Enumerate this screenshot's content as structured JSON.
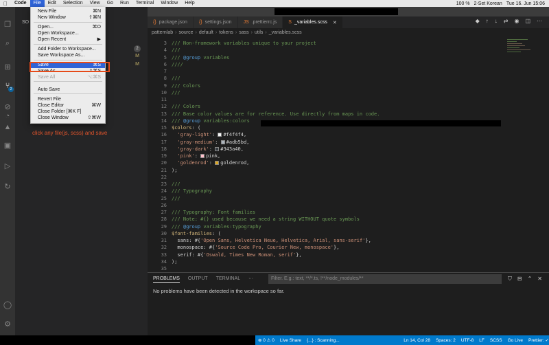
{
  "menubar": {
    "apple": "",
    "items": [
      "Code",
      "File",
      "Edit",
      "Selection",
      "View",
      "Go",
      "Run",
      "Terminal",
      "Window",
      "Help"
    ],
    "right": [
      "100 %",
      "2-Set Korean",
      "Tue 16. Jun 15:06"
    ]
  },
  "activitybar": {
    "badge": "2",
    "icons": [
      "files-icon",
      "search-icon",
      "extensions-icon",
      "source-control-icon",
      "run-icon",
      "deploy-icon",
      "remote-icon",
      "docker-icon",
      "test-icon",
      "live-share-icon",
      "account-icon",
      "settings-gear-icon"
    ]
  },
  "sidebar": {
    "header": "SO",
    "badge": "2",
    "m1": "M",
    "m2": "M"
  },
  "file_menu": {
    "items": [
      {
        "label": "New File",
        "shortcut": "⌘N",
        "state": "normal"
      },
      {
        "label": "New Window",
        "shortcut": "⇧⌘N",
        "state": "normal"
      },
      {
        "label": "Open...",
        "shortcut": "⌘O",
        "state": "normal"
      },
      {
        "label": "Open Workspace...",
        "shortcut": "",
        "state": "normal"
      },
      {
        "label": "Open Recent",
        "shortcut": "▶",
        "state": "normal"
      },
      {
        "label": "Add Folder to Workspace...",
        "shortcut": "",
        "state": "normal"
      },
      {
        "label": "Save Workspace As...",
        "shortcut": "",
        "state": "normal"
      },
      {
        "label": "Save",
        "shortcut": "⌘S",
        "state": "selected"
      },
      {
        "label": "Save As...",
        "shortcut": "⇧⌘S",
        "state": "normal"
      },
      {
        "label": "Save All",
        "shortcut": "⌥⌘S",
        "state": "disabled"
      },
      {
        "label": "Auto Save",
        "shortcut": "",
        "state": "normal"
      },
      {
        "label": "Revert File",
        "shortcut": "",
        "state": "normal"
      },
      {
        "label": "Close Editor",
        "shortcut": "⌘W",
        "state": "normal"
      },
      {
        "label": "Close Folder [⌘K F]",
        "shortcut": "",
        "state": "normal"
      },
      {
        "label": "Close Window",
        "shortcut": "⇧⌘W",
        "state": "normal"
      }
    ]
  },
  "annotation": "click any file(js, scss) and  save",
  "tabs": [
    {
      "label": "package.json",
      "icon": "{}",
      "active": false
    },
    {
      "label": "settings.json",
      "icon": "{}",
      "active": false
    },
    {
      "label": ".prettierrc.js",
      "icon": "JS",
      "active": false
    },
    {
      "label": "_variables.scss",
      "icon": "S",
      "active": true
    }
  ],
  "breadcrumb": [
    "patternlab",
    "source",
    "default",
    "tokens",
    "sass",
    "utils",
    "_variables.scss"
  ],
  "code": [
    {
      "n": "3",
      "parts": [
        [
          "c-com",
          "/// Non-framework variables unique to your project"
        ]
      ]
    },
    {
      "n": "4",
      "parts": [
        [
          "c-com",
          "///"
        ]
      ]
    },
    {
      "n": "5",
      "parts": [
        [
          "c-com",
          "/// "
        ],
        [
          "c-kw",
          "@group"
        ],
        [
          "c-com",
          " variables"
        ]
      ]
    },
    {
      "n": "6",
      "parts": [
        [
          "c-com",
          "////"
        ]
      ]
    },
    {
      "n": "7",
      "parts": []
    },
    {
      "n": "8",
      "parts": [
        [
          "c-com",
          "///"
        ]
      ]
    },
    {
      "n": "9",
      "parts": [
        [
          "c-com",
          "/// Colors"
        ]
      ]
    },
    {
      "n": "10",
      "parts": [
        [
          "c-com",
          "///"
        ]
      ]
    },
    {
      "n": "11",
      "parts": []
    },
    {
      "n": "12",
      "parts": [
        [
          "c-com",
          "/// Colors"
        ]
      ]
    },
    {
      "n": "13",
      "parts": [
        [
          "c-com",
          "/// Base color values are for reference. Use directly from maps in code."
        ]
      ]
    },
    {
      "n": "14",
      "parts": [
        [
          "c-com",
          "/// "
        ],
        [
          "c-kw",
          "@group"
        ],
        [
          "c-com",
          " variables:colors"
        ]
      ]
    },
    {
      "n": "15",
      "parts": [
        [
          "c-var",
          "$colors"
        ],
        [
          "c-txt",
          ": ("
        ]
      ]
    },
    {
      "n": "16",
      "parts": [
        [
          "c-txt",
          "  "
        ],
        [
          "c-str",
          "'gray-light'"
        ],
        [
          "c-txt",
          ": "
        ],
        [
          "sw:#f4f4f4",
          ""
        ],
        [
          "c-txt",
          "#f4f4f4,"
        ]
      ]
    },
    {
      "n": "17",
      "parts": [
        [
          "c-txt",
          "  "
        ],
        [
          "c-str",
          "'gray-medium'"
        ],
        [
          "c-txt",
          ": "
        ],
        [
          "sw:#adb5bd",
          ""
        ],
        [
          "c-txt",
          "#adb5bd,"
        ]
      ]
    },
    {
      "n": "18",
      "parts": [
        [
          "c-txt",
          "  "
        ],
        [
          "c-str",
          "'gray-dark'"
        ],
        [
          "c-txt",
          ": "
        ],
        [
          "sw:#343a40",
          ""
        ],
        [
          "c-txt",
          "#343a40,"
        ]
      ]
    },
    {
      "n": "19",
      "parts": [
        [
          "c-txt",
          "  "
        ],
        [
          "c-str",
          "'pink'"
        ],
        [
          "c-txt",
          ": "
        ],
        [
          "sw:#ffc0cb",
          ""
        ],
        [
          "c-txt",
          "pink,"
        ]
      ]
    },
    {
      "n": "20",
      "parts": [
        [
          "c-txt",
          "  "
        ],
        [
          "c-str",
          "'goldenrod'"
        ],
        [
          "c-txt",
          ": "
        ],
        [
          "sw:#daa520",
          ""
        ],
        [
          "c-txt",
          "goldenrod,"
        ]
      ]
    },
    {
      "n": "21",
      "parts": [
        [
          "c-txt",
          ");"
        ]
      ]
    },
    {
      "n": "22",
      "parts": []
    },
    {
      "n": "23",
      "parts": [
        [
          "c-com",
          "///"
        ]
      ]
    },
    {
      "n": "24",
      "parts": [
        [
          "c-com",
          "/// Typography"
        ]
      ]
    },
    {
      "n": "25",
      "parts": [
        [
          "c-com",
          "///"
        ]
      ]
    },
    {
      "n": "26",
      "parts": []
    },
    {
      "n": "27",
      "parts": [
        [
          "c-com",
          "/// Typography: Font families"
        ]
      ]
    },
    {
      "n": "28",
      "parts": [
        [
          "c-com",
          "/// Note: #{} used because we need a string WITHOUT quote symbols"
        ]
      ]
    },
    {
      "n": "29",
      "parts": [
        [
          "c-com",
          "/// "
        ],
        [
          "c-kw",
          "@group"
        ],
        [
          "c-com",
          " variables:typography"
        ]
      ]
    },
    {
      "n": "30",
      "parts": [
        [
          "c-var",
          "$font-families"
        ],
        [
          "c-txt",
          ": ("
        ]
      ]
    },
    {
      "n": "31",
      "parts": [
        [
          "c-txt",
          "  sans: #{"
        ],
        [
          "c-str",
          "'Open Sans, Helvetica Neue, Helvetica, Arial, sans-serif'"
        ],
        [
          "c-txt",
          "},"
        ]
      ]
    },
    {
      "n": "32",
      "parts": [
        [
          "c-txt",
          "  monospace: #{"
        ],
        [
          "c-str",
          "'Source Code Pro, Courier New, monospace'"
        ],
        [
          "c-txt",
          "},"
        ]
      ]
    },
    {
      "n": "33",
      "parts": [
        [
          "c-txt",
          "  serif: #{"
        ],
        [
          "c-str",
          "'Oswald, Times New Roman, serif'"
        ],
        [
          "c-txt",
          "},"
        ]
      ]
    },
    {
      "n": "34",
      "parts": [
        [
          "c-txt",
          ");"
        ]
      ]
    },
    {
      "n": "35",
      "parts": []
    }
  ],
  "panel": {
    "tabs": [
      "PROBLEMS",
      "OUTPUT",
      "TERMINAL",
      "···"
    ],
    "filter_placeholder": "Filter. E.g.: text, **/*.ts, !**/node_modules/**",
    "message": "No problems have been detected in the workspace so far."
  },
  "statusbar": {
    "problems": "⊗ 0  ⚠ 0",
    "liveshare": "Live Share",
    "scanning": "{...} : Scanning...",
    "position": "Ln 14, Col 28",
    "spaces": "Spaces: 2",
    "encoding": "UTF-8",
    "eol": "LF",
    "language": "SCSS",
    "golive": "Go Live",
    "prettier": "Prettier: ✓"
  }
}
